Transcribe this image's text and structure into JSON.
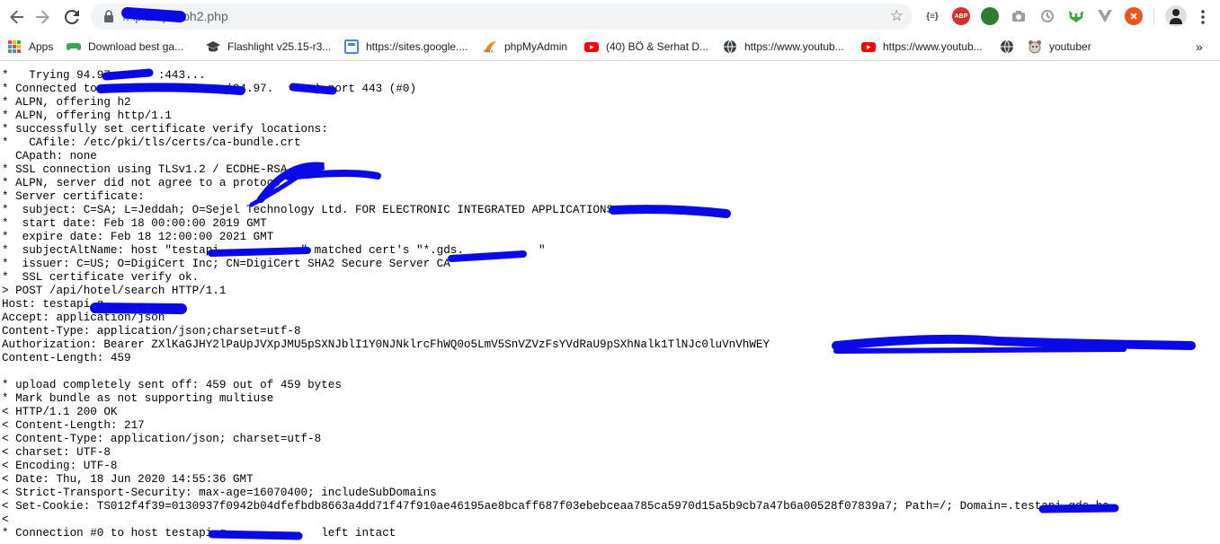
{
  "browser": {
    "url_prefix": "",
    "url_path": "/Api2/apimoh2.php"
  },
  "toolbar": {
    "back_icon": "arrow-left-icon",
    "forward_icon": "arrow-right-icon",
    "reload_icon": "reload-icon",
    "star_icon": "star-icon",
    "menu_icon": "three-dots-icon",
    "extensions": [
      {
        "name": "json-viewer-extension",
        "label": "{≡}",
        "color": "#444444"
      },
      {
        "name": "adblock-plus-extension",
        "label": "ABP",
        "color": "#d32f2f"
      },
      {
        "name": "globe-extension",
        "label": "",
        "color": "#2e7d32"
      },
      {
        "name": "camera-extension",
        "label": "",
        "color": "#9e9e9e"
      },
      {
        "name": "history-extension",
        "label": "",
        "color": "#9e9e9e"
      },
      {
        "name": "owl-extension",
        "label": "",
        "color": "#43a047"
      },
      {
        "name": "vue-extension",
        "label": "",
        "color": "#9e9e9e"
      },
      {
        "name": "orange-circle-extension",
        "label": "",
        "color": "#f4511e"
      }
    ]
  },
  "bookmarks": [
    {
      "label": "Apps",
      "icon": "apps-grid-icon",
      "color": "#e8453c"
    },
    {
      "label": "Download best ga...",
      "icon": "gamepad-icon",
      "color": "#34a853"
    },
    {
      "label": "Flashlight v25.15-r3...",
      "icon": "graduation-cap-icon",
      "color": "#3c4043"
    },
    {
      "label": "https://sites.google....",
      "icon": "sites-icon",
      "color": "#4285f4"
    },
    {
      "label": "phpMyAdmin",
      "icon": "phpmyadmin-icon",
      "color": "#f29111"
    },
    {
      "label": "(40) BÖ & Serhat D...",
      "icon": "youtube-icon",
      "color": "#ff0000"
    },
    {
      "label": "https://www.youtub...",
      "icon": "globe-icon",
      "color": "#3c4043"
    },
    {
      "label": "https://www.youtub...",
      "icon": "youtube-icon",
      "color": "#ff0000"
    },
    {
      "label": "",
      "icon": "globe-icon",
      "color": "#3c4043"
    },
    {
      "label": "youtuber",
      "icon": "bear-icon",
      "color": "#8d6e63"
    }
  ],
  "bookmarks_overflow": "»",
  "output_lines": [
    "*   Trying 94.97.      :443...",
    "* Connected to                   (94.97.      ) port 443 (#0)",
    "* ALPN, offering h2",
    "* ALPN, offering http/1.1",
    "* successfully set certificate verify locations:",
    "*   CAfile: /etc/pki/tls/certs/ca-bundle.crt",
    "  CApath: none",
    "* SSL connection using TLSv1.2 / ECDHE-RSA-",
    "* ALPN, server did not agree to a protoco",
    "* Server certificate:",
    "*  subject: C=SA; L=Jeddah; O=Sejel Technology Ltd. FOR ELECTRONIC INTEGRATED APPLICATIONS; CN=",
    "*  start date: Feb 18 00:00:00 2019 GMT",
    "*  expire date: Feb 18 12:00:00 2021 GMT",
    "*  subjectAltName: host \"testapi.           \" matched cert's \"*.gds.           \"",
    "*  issuer: C=US; O=DigiCert Inc; CN=DigiCert SHA2 Secure Server CA",
    "*  SSL certificate verify ok.",
    "> POST /api/hotel/search HTTP/1.1",
    "Host: testapi.g",
    "Accept: application/json",
    "Content-Type: application/json;charset=utf-8",
    "Authorization: Bearer ZXlKaGJHY2lPaUpJVXpJMU5pSXNJblI1Y0NJNklrcFhWQ0o5LmV5SnVZVzFsYVdRaU9pSXhNalk1TlNJc0luVnVhWEY",
    "Content-Length: 459",
    "",
    "* upload completely sent off: 459 out of 459 bytes",
    "* Mark bundle as not supporting multiuse",
    "< HTTP/1.1 200 OK",
    "< Content-Length: 217",
    "< Content-Type: application/json; charset=utf-8",
    "< charset: UTF-8",
    "< Encoding: UTF-8",
    "< Date: Thu, 18 Jun 2020 14:55:36 GMT",
    "< Strict-Transport-Security: max-age=16070400; includeSubDomains",
    "< Set-Cookie: TS012f4f39=0130937f0942b04dfefbdb8663a4dd71f47f910ae46195ae8bcaff687f03ebebceaa785ca5970d15a5b9cb7a47b6a00528f07839a7; Path=/; Domain=.testapi.gds.ha",
    "<",
    "* Connection #0 to host testapi.g              left intact"
  ]
}
